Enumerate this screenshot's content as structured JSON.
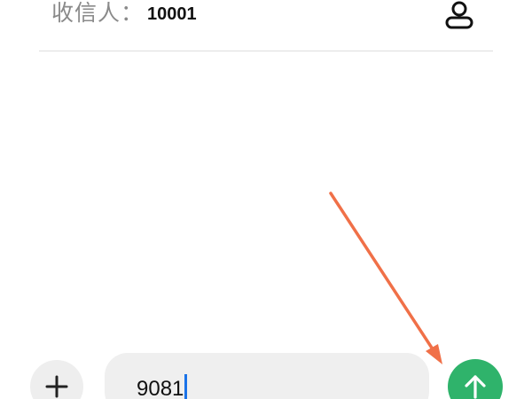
{
  "recipient": {
    "label": "收信人：",
    "value": "10001"
  },
  "composer": {
    "message_value": "9081"
  },
  "icons": {
    "contact": "person-icon",
    "add": "plus-icon",
    "send": "arrow-up-icon"
  },
  "colors": {
    "send_button": "#2fb36b",
    "annotation_arrow": "#f07048",
    "caret": "#1a73e8"
  }
}
